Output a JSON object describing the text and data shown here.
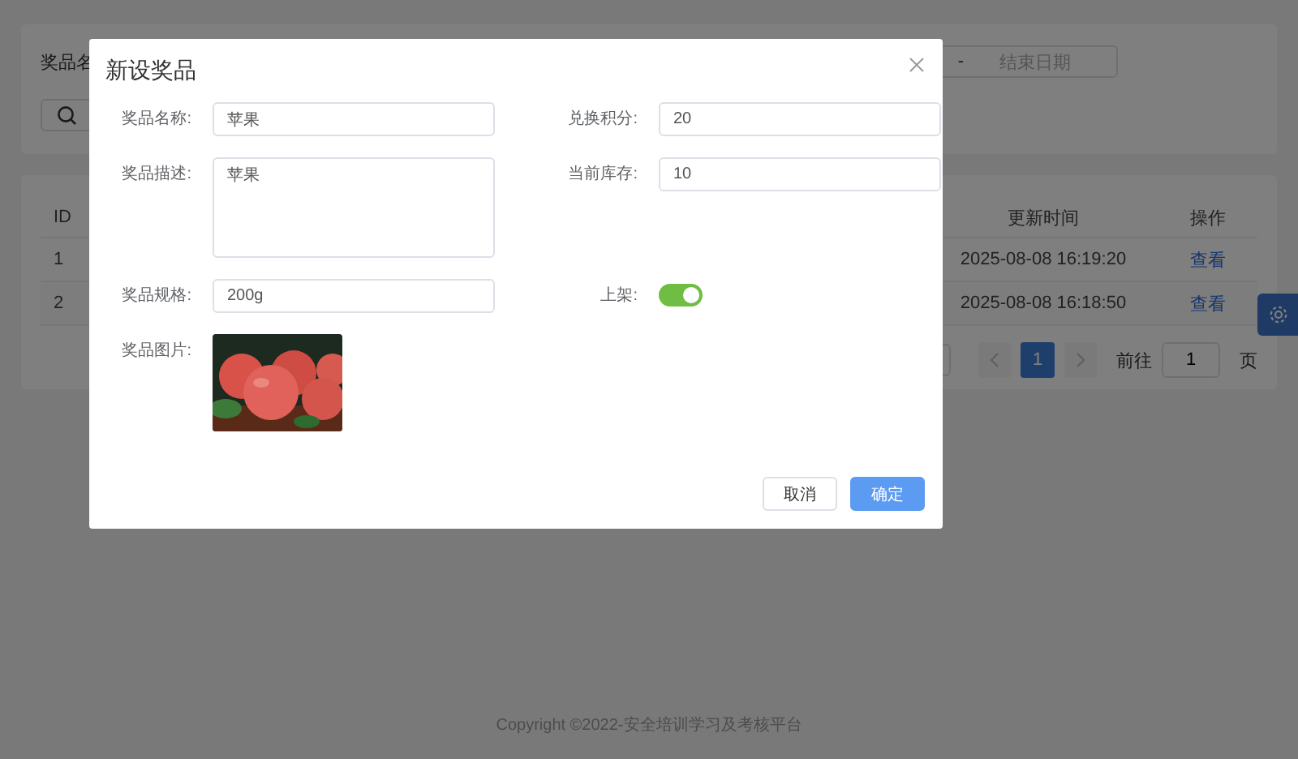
{
  "background": {
    "filter": {
      "name_label": "奖品名",
      "date_separator": "-",
      "end_date_placeholder": "结束日期"
    },
    "table": {
      "columns": [
        "ID",
        "更新时间",
        "操作"
      ],
      "rows": [
        {
          "id": "1",
          "updated": "2025-08-08 16:19:20",
          "action": "查看"
        },
        {
          "id": "2",
          "updated": "2025-08-08 16:18:50",
          "action": "查看"
        }
      ]
    },
    "pagination": {
      "pages": [
        {
          "label": "1",
          "selected": true
        }
      ],
      "goto_label": "前往",
      "goto_value": "1",
      "page_unit": "页"
    }
  },
  "dialog": {
    "title": "新设奖品",
    "fields": [
      {
        "kind": "text",
        "label": "奖品名称:",
        "value": "苹果"
      },
      {
        "kind": "text",
        "label": "兑换积分:",
        "value": "20"
      },
      {
        "kind": "textarea",
        "label": "奖品描述:",
        "value": "苹果"
      },
      {
        "kind": "text",
        "label": "当前库存:",
        "value": "10"
      },
      {
        "kind": "text",
        "label": "奖品规格:",
        "value": "200g"
      },
      {
        "kind": "switch",
        "label": "上架:",
        "on": true
      },
      {
        "label": "奖品图片:"
      }
    ],
    "buttons": [
      {
        "label": "取消",
        "kind": "default"
      },
      {
        "label": "确定",
        "kind": "primary"
      }
    ]
  },
  "footer": "Copyright ©2022-安全培训学习及考核平台"
}
